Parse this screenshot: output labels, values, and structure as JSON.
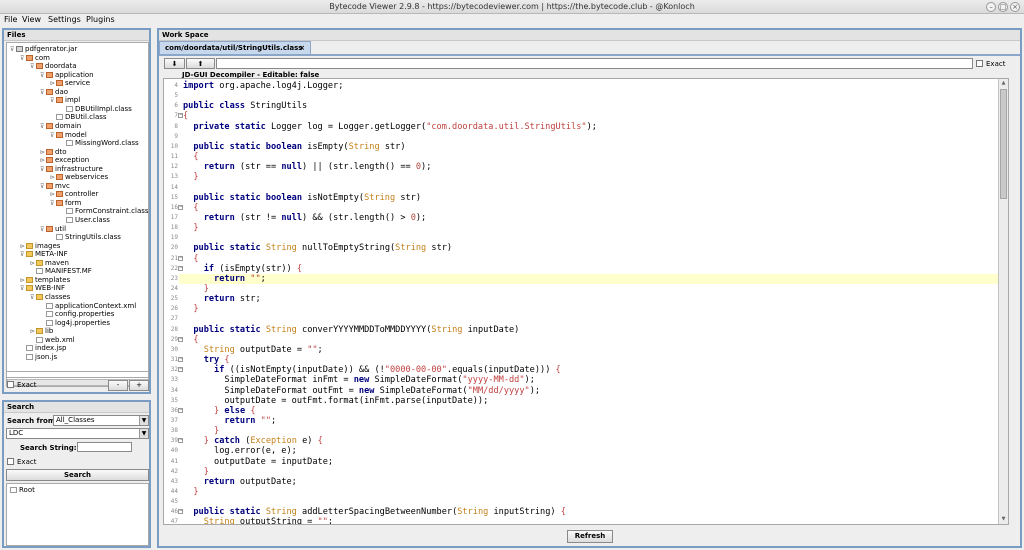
{
  "window": {
    "title": "Bytecode Viewer 2.9.8 - https://bytecodeviewer.com | https://the.bytecode.club - @Konloch"
  },
  "menu": [
    "File",
    "View",
    "Settings",
    "Plugins"
  ],
  "files_panel": {
    "title": "Files",
    "tree": [
      {
        "label": "pdfgenrator.jar",
        "icon": "jar",
        "depth": 0,
        "toggle": "open"
      },
      {
        "label": "com",
        "icon": "package",
        "depth": 1,
        "toggle": "open"
      },
      {
        "label": "doordata",
        "icon": "package",
        "depth": 2,
        "toggle": "open"
      },
      {
        "label": "application",
        "icon": "package",
        "depth": 3,
        "toggle": "open"
      },
      {
        "label": "service",
        "icon": "package",
        "depth": 4,
        "toggle": "closed"
      },
      {
        "label": "dao",
        "icon": "package",
        "depth": 3,
        "toggle": "open"
      },
      {
        "label": "impl",
        "icon": "package",
        "depth": 4,
        "toggle": "open"
      },
      {
        "label": "DBUtilImpl.class",
        "icon": "file",
        "depth": 5,
        "toggle": ""
      },
      {
        "label": "DBUtil.class",
        "icon": "file",
        "depth": 4,
        "toggle": ""
      },
      {
        "label": "domain",
        "icon": "package",
        "depth": 3,
        "toggle": "open"
      },
      {
        "label": "model",
        "icon": "package",
        "depth": 4,
        "toggle": "open"
      },
      {
        "label": "MissingWord.class",
        "icon": "file",
        "depth": 5,
        "toggle": ""
      },
      {
        "label": "dto",
        "icon": "package",
        "depth": 3,
        "toggle": "closed"
      },
      {
        "label": "exception",
        "icon": "package",
        "depth": 3,
        "toggle": "closed"
      },
      {
        "label": "infrastructure",
        "icon": "package",
        "depth": 3,
        "toggle": "open"
      },
      {
        "label": "webservices",
        "icon": "package",
        "depth": 4,
        "toggle": "closed"
      },
      {
        "label": "mvc",
        "icon": "package",
        "depth": 3,
        "toggle": "open"
      },
      {
        "label": "controller",
        "icon": "package",
        "depth": 4,
        "toggle": "closed"
      },
      {
        "label": "form",
        "icon": "package",
        "depth": 4,
        "toggle": "open"
      },
      {
        "label": "FormConstraint.class",
        "icon": "file",
        "depth": 5,
        "toggle": ""
      },
      {
        "label": "User.class",
        "icon": "file",
        "depth": 5,
        "toggle": ""
      },
      {
        "label": "util",
        "icon": "package",
        "depth": 3,
        "toggle": "open"
      },
      {
        "label": "StringUtils.class",
        "icon": "file",
        "depth": 4,
        "toggle": ""
      },
      {
        "label": "images",
        "icon": "folder",
        "depth": 1,
        "toggle": "closed"
      },
      {
        "label": "META-INF",
        "icon": "folder",
        "depth": 1,
        "toggle": "open"
      },
      {
        "label": "maven",
        "icon": "folder",
        "depth": 2,
        "toggle": "closed"
      },
      {
        "label": "MANIFEST.MF",
        "icon": "file",
        "depth": 2,
        "toggle": ""
      },
      {
        "label": "templates",
        "icon": "folder",
        "depth": 1,
        "toggle": "closed"
      },
      {
        "label": "WEB-INF",
        "icon": "folder",
        "depth": 1,
        "toggle": "open"
      },
      {
        "label": "classes",
        "icon": "folder",
        "depth": 2,
        "toggle": "open"
      },
      {
        "label": "applicationContext.xml",
        "icon": "file",
        "depth": 3,
        "toggle": ""
      },
      {
        "label": "config.properties",
        "icon": "file",
        "depth": 3,
        "toggle": ""
      },
      {
        "label": "log4j.properties",
        "icon": "file",
        "depth": 3,
        "toggle": ""
      },
      {
        "label": "lib",
        "icon": "folder",
        "depth": 2,
        "toggle": "closed"
      },
      {
        "label": "web.xml",
        "icon": "file",
        "depth": 2,
        "toggle": ""
      },
      {
        "label": "index.jsp",
        "icon": "file",
        "depth": 1,
        "toggle": ""
      },
      {
        "label": "json.js",
        "icon": "file",
        "depth": 1,
        "toggle": ""
      }
    ],
    "exact_label": "Exact",
    "minus_label": "-",
    "plus_label": "+"
  },
  "search_panel": {
    "title": "Search",
    "search_from_label": "Search from",
    "search_from_value": "All_Classes",
    "decompiler_value": "LDC",
    "search_string_label": "Search String:",
    "search_string_value": "",
    "exact_label": "Exact",
    "search_button": "Search",
    "results_root": "Root"
  },
  "workspace": {
    "title": "Work Space",
    "tab_label": "com/doordata/util/StringUtils.class",
    "tab_close": "×",
    "toolbar": {
      "down_label": "⬇",
      "up_label": "⬆",
      "exact_label": "Exact"
    },
    "decompiler_label": "JD-GUI Decompiler - Editable: false",
    "refresh_button": "Refresh",
    "highlight_line": 23,
    "code": [
      {
        "n": 4,
        "t": [
          [
            "kw",
            "import"
          ],
          [
            "p",
            " org.apache.log4j.Logger;"
          ]
        ]
      },
      {
        "n": 5,
        "t": []
      },
      {
        "n": 6,
        "t": [
          [
            "kw",
            "public class"
          ],
          [
            "p",
            " StringUtils"
          ]
        ]
      },
      {
        "n": 7,
        "fold": true,
        "t": [
          [
            "op",
            "{"
          ]
        ]
      },
      {
        "n": 8,
        "t": [
          [
            "p",
            "  "
          ],
          [
            "kw",
            "private static"
          ],
          [
            "p",
            " Logger log = Logger.getLogger("
          ],
          [
            "st",
            "\"com.doordata.util.StringUtils\""
          ],
          [
            "p",
            ");"
          ]
        ]
      },
      {
        "n": 9,
        "t": []
      },
      {
        "n": 10,
        "t": [
          [
            "p",
            "  "
          ],
          [
            "kw",
            "public static boolean"
          ],
          [
            "p",
            " isEmpty("
          ],
          [
            "ty",
            "String"
          ],
          [
            "p",
            " str)"
          ]
        ]
      },
      {
        "n": 11,
        "t": [
          [
            "p",
            "  "
          ],
          [
            "op",
            "{"
          ]
        ]
      },
      {
        "n": 12,
        "t": [
          [
            "p",
            "    "
          ],
          [
            "kw",
            "return"
          ],
          [
            "p",
            " (str == "
          ],
          [
            "kw",
            "null"
          ],
          [
            "p",
            ") || (str.length() == "
          ],
          [
            "nm",
            "0"
          ],
          [
            "p",
            ");"
          ]
        ]
      },
      {
        "n": 13,
        "t": [
          [
            "p",
            "  "
          ],
          [
            "op",
            "}"
          ]
        ]
      },
      {
        "n": 14,
        "t": []
      },
      {
        "n": 15,
        "t": [
          [
            "p",
            "  "
          ],
          [
            "kw",
            "public static boolean"
          ],
          [
            "p",
            " isNotEmpty("
          ],
          [
            "ty",
            "String"
          ],
          [
            "p",
            " str)"
          ]
        ]
      },
      {
        "n": 16,
        "fold": true,
        "t": [
          [
            "p",
            "  "
          ],
          [
            "op",
            "{"
          ]
        ]
      },
      {
        "n": 17,
        "t": [
          [
            "p",
            "    "
          ],
          [
            "kw",
            "return"
          ],
          [
            "p",
            " (str != "
          ],
          [
            "kw",
            "null"
          ],
          [
            "p",
            ") && (str.length() > "
          ],
          [
            "nm",
            "0"
          ],
          [
            "p",
            ");"
          ]
        ]
      },
      {
        "n": 18,
        "t": [
          [
            "p",
            "  "
          ],
          [
            "op",
            "}"
          ]
        ]
      },
      {
        "n": 19,
        "t": []
      },
      {
        "n": 20,
        "t": [
          [
            "p",
            "  "
          ],
          [
            "kw",
            "public static"
          ],
          [
            "p",
            " "
          ],
          [
            "ty",
            "String"
          ],
          [
            "p",
            " nullToEmptyString("
          ],
          [
            "ty",
            "String"
          ],
          [
            "p",
            " str)"
          ]
        ]
      },
      {
        "n": 21,
        "fold": true,
        "t": [
          [
            "p",
            "  "
          ],
          [
            "op",
            "{"
          ]
        ]
      },
      {
        "n": 22,
        "fold": true,
        "t": [
          [
            "p",
            "    "
          ],
          [
            "kw",
            "if"
          ],
          [
            "p",
            " (isEmpty(str)) "
          ],
          [
            "op",
            "{"
          ]
        ]
      },
      {
        "n": 23,
        "t": [
          [
            "p",
            "      "
          ],
          [
            "kw",
            "return"
          ],
          [
            "p",
            " "
          ],
          [
            "st",
            "\"\""
          ],
          [
            "p",
            ";"
          ]
        ]
      },
      {
        "n": 24,
        "t": [
          [
            "p",
            "    "
          ],
          [
            "op",
            "}"
          ]
        ]
      },
      {
        "n": 25,
        "t": [
          [
            "p",
            "    "
          ],
          [
            "kw",
            "return"
          ],
          [
            "p",
            " str;"
          ]
        ]
      },
      {
        "n": 26,
        "t": [
          [
            "p",
            "  "
          ],
          [
            "op",
            "}"
          ]
        ]
      },
      {
        "n": 27,
        "t": []
      },
      {
        "n": 28,
        "t": [
          [
            "p",
            "  "
          ],
          [
            "kw",
            "public static"
          ],
          [
            "p",
            " "
          ],
          [
            "ty",
            "String"
          ],
          [
            "p",
            " converYYYYMMDDToMMDDYYYY("
          ],
          [
            "ty",
            "String"
          ],
          [
            "p",
            " inputDate)"
          ]
        ]
      },
      {
        "n": 29,
        "fold": true,
        "t": [
          [
            "p",
            "  "
          ],
          [
            "op",
            "{"
          ]
        ]
      },
      {
        "n": 30,
        "t": [
          [
            "p",
            "    "
          ],
          [
            "ty",
            "String"
          ],
          [
            "p",
            " outputDate = "
          ],
          [
            "st",
            "\"\""
          ],
          [
            "p",
            ";"
          ]
        ]
      },
      {
        "n": 31,
        "fold": true,
        "t": [
          [
            "p",
            "    "
          ],
          [
            "kw",
            "try"
          ],
          [
            "p",
            " "
          ],
          [
            "op",
            "{"
          ]
        ]
      },
      {
        "n": 32,
        "fold": true,
        "t": [
          [
            "p",
            "      "
          ],
          [
            "kw",
            "if"
          ],
          [
            "p",
            " ((isNotEmpty(inputDate)) && (!"
          ],
          [
            "st",
            "\"0000-00-00\""
          ],
          [
            "p",
            ".equals(inputDate))) "
          ],
          [
            "op",
            "{"
          ]
        ]
      },
      {
        "n": 33,
        "t": [
          [
            "p",
            "        SimpleDateFormat inFmt = "
          ],
          [
            "kw",
            "new"
          ],
          [
            "p",
            " SimpleDateFormat("
          ],
          [
            "st",
            "\"yyyy-MM-dd\""
          ],
          [
            "p",
            ");"
          ]
        ]
      },
      {
        "n": 34,
        "t": [
          [
            "p",
            "        SimpleDateFormat outFmt = "
          ],
          [
            "kw",
            "new"
          ],
          [
            "p",
            " SimpleDateFormat("
          ],
          [
            "st",
            "\"MM/dd/yyyy\""
          ],
          [
            "p",
            ");"
          ]
        ]
      },
      {
        "n": 35,
        "t": [
          [
            "p",
            "        outputDate = outFmt.format(inFmt.parse(inputDate));"
          ]
        ]
      },
      {
        "n": 36,
        "fold": true,
        "t": [
          [
            "p",
            "      "
          ],
          [
            "op",
            "}"
          ],
          [
            "p",
            " "
          ],
          [
            "kw",
            "else"
          ],
          [
            "p",
            " "
          ],
          [
            "op",
            "{"
          ]
        ]
      },
      {
        "n": 37,
        "t": [
          [
            "p",
            "        "
          ],
          [
            "kw",
            "return"
          ],
          [
            "p",
            " "
          ],
          [
            "st",
            "\"\""
          ],
          [
            "p",
            ";"
          ]
        ]
      },
      {
        "n": 38,
        "t": [
          [
            "p",
            "      "
          ],
          [
            "op",
            "}"
          ]
        ]
      },
      {
        "n": 39,
        "fold": true,
        "t": [
          [
            "p",
            "    "
          ],
          [
            "op",
            "}"
          ],
          [
            "p",
            " "
          ],
          [
            "kw",
            "catch"
          ],
          [
            "p",
            " ("
          ],
          [
            "ty",
            "Exception"
          ],
          [
            "p",
            " e) "
          ],
          [
            "op",
            "{"
          ]
        ]
      },
      {
        "n": 40,
        "t": [
          [
            "p",
            "      log.error(e, e);"
          ]
        ]
      },
      {
        "n": 41,
        "t": [
          [
            "p",
            "      outputDate = inputDate;"
          ]
        ]
      },
      {
        "n": 42,
        "t": [
          [
            "p",
            "    "
          ],
          [
            "op",
            "}"
          ]
        ]
      },
      {
        "n": 43,
        "t": [
          [
            "p",
            "    "
          ],
          [
            "kw",
            "return"
          ],
          [
            "p",
            " outputDate;"
          ]
        ]
      },
      {
        "n": 44,
        "t": [
          [
            "p",
            "  "
          ],
          [
            "op",
            "}"
          ]
        ]
      },
      {
        "n": 45,
        "t": []
      },
      {
        "n": 46,
        "fold": true,
        "t": [
          [
            "p",
            "  "
          ],
          [
            "kw",
            "public static"
          ],
          [
            "p",
            " "
          ],
          [
            "ty",
            "String"
          ],
          [
            "p",
            " addLetterSpacingBetweenNumber("
          ],
          [
            "ty",
            "String"
          ],
          [
            "p",
            " inputString) "
          ],
          [
            "op",
            "{"
          ]
        ]
      },
      {
        "n": 47,
        "t": [
          [
            "p",
            "    "
          ],
          [
            "ty",
            "String"
          ],
          [
            "p",
            " outputString = "
          ],
          [
            "st",
            "\"\""
          ],
          [
            "p",
            ";"
          ]
        ]
      }
    ]
  }
}
